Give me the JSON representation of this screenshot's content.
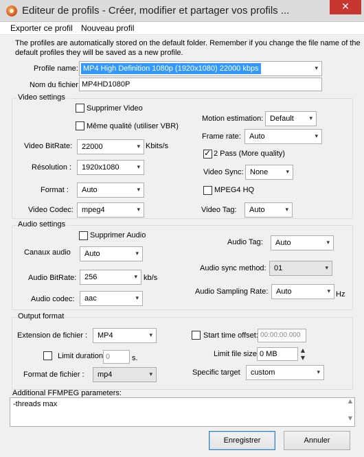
{
  "window": {
    "title": "Editeur de profils - Créer, modifier et partager vos profils ...",
    "close_glyph": "✕"
  },
  "menu": {
    "export_label": "Exporter ce profil",
    "new_label": "Nouveau profil"
  },
  "info_text_line1": "The profiles are automatically stored on the default folder. Remember if you change the file name of the",
  "info_text_line2": "default profiles they will be saved as a new profile.",
  "profile": {
    "name_label": "Profile name:",
    "name_value": "MP4 High Definition 1080p (1920x1080) 22000 kbps",
    "filename_label": "Nom du fichier",
    "filename_value": "MP4HD1080P"
  },
  "video": {
    "group_label": "Video settings",
    "suppress_label": "Supprimer Video",
    "suppress_checked": false,
    "same_quality_label": "Même qualité (utiliser VBR)",
    "same_quality_checked": false,
    "bitrate_label": "Video BitRate:",
    "bitrate_value": "22000",
    "bitrate_unit": "Kbits/s",
    "resolution_label": "Résolution :",
    "resolution_value": "1920x1080",
    "format_label": "Format :",
    "format_value": "Auto",
    "codec_label": "Video Codec:",
    "codec_value": "mpeg4",
    "motion_label": "Motion estimation:",
    "motion_value": "Default",
    "framerate_label": "Frame rate:",
    "framerate_value": "Auto",
    "twopass_label": "2 Pass (More quality)",
    "twopass_checked": true,
    "sync_label": "Video Sync:",
    "sync_value": "None",
    "mpeg4hq_label": "MPEG4 HQ",
    "mpeg4hq_checked": false,
    "tag_label": "Video Tag:",
    "tag_value": "Auto"
  },
  "audio": {
    "group_label": "Audio settings",
    "suppress_label": "Supprimer Audio",
    "suppress_checked": false,
    "channels_label": "Canaux audio",
    "channels_value": "Auto",
    "bitrate_label": "Audio BitRate:",
    "bitrate_value": "256",
    "bitrate_unit": "kb/s",
    "codec_label": "Audio codec:",
    "codec_value": "aac",
    "tag_label": "Audio Tag:",
    "tag_value": "Auto",
    "sync_label": "Audio sync method:",
    "sync_value": "01",
    "sampling_label": "Audio Sampling Rate:",
    "sampling_value": "Auto",
    "sampling_unit": "Hz"
  },
  "output": {
    "group_label": "Output format",
    "extension_label": "Extension de fichier :",
    "extension_value": "MP4",
    "limit_duration_label": "Limit duration:",
    "limit_duration_checked": false,
    "limit_duration_value": "0",
    "limit_duration_unit": "s.",
    "file_format_label": "Format de fichier :",
    "file_format_value": "mp4",
    "start_offset_label": "Start time offset:",
    "start_offset_checked": false,
    "start_offset_value": "00:00:00.000",
    "limit_size_label": "Limit file size:",
    "limit_size_value": "0 MB",
    "target_label": "Specific target",
    "target_value": "custom"
  },
  "ffmpeg": {
    "label": "Additional FFMPEG parameters:",
    "value": "-threads max"
  },
  "buttons": {
    "save_label": "Enregistrer",
    "cancel_label": "Annuler"
  },
  "icons": {
    "dropdown": "▾",
    "spin_up": "▲",
    "spin_down": "▼"
  }
}
